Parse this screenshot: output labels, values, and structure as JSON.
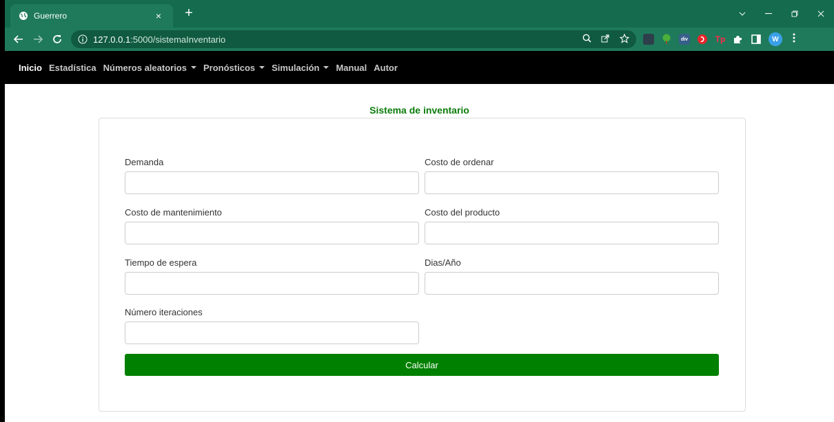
{
  "browser": {
    "tab_title": "Guerrero",
    "tab_close": "×",
    "new_tab": "+",
    "url_host": "127.0.0.1",
    "url_rest": ":5000/sistemaInventario",
    "extensions": [
      "ext-dark",
      "ext-tree",
      "ext-div",
      "ext-red",
      "ext-tp",
      "puzzle",
      "panel"
    ],
    "ext_div_label": "div",
    "ext_tp_label": "Tp",
    "profile_initial": "W",
    "accent_color": "#146b4e"
  },
  "navbar": {
    "items": [
      {
        "label": "Inicio",
        "dropdown": false,
        "active": true
      },
      {
        "label": "Estadística",
        "dropdown": false,
        "active": false
      },
      {
        "label": "Números aleatorios",
        "dropdown": true,
        "active": false
      },
      {
        "label": "Pronósticos",
        "dropdown": true,
        "active": false
      },
      {
        "label": "Simulación",
        "dropdown": true,
        "active": false
      },
      {
        "label": "Manual",
        "dropdown": false,
        "active": false
      },
      {
        "label": "Autor",
        "dropdown": false,
        "active": false
      }
    ]
  },
  "form": {
    "title": "Sistema de inventario",
    "fields": {
      "demanda": {
        "label": "Demanda",
        "value": ""
      },
      "costo_ordenar": {
        "label": "Costo de ordenar",
        "value": ""
      },
      "costo_mantenimiento": {
        "label": "Costo de mantenimiento",
        "value": ""
      },
      "costo_producto": {
        "label": "Costo del producto",
        "value": ""
      },
      "tiempo_espera": {
        "label": "Tiempo de espera",
        "value": ""
      },
      "dias_ano": {
        "label": "Dias/Año",
        "value": ""
      },
      "num_iteraciones": {
        "label": "Número iteraciones",
        "value": ""
      }
    },
    "submit_label": "Calcular",
    "button_color": "#008000",
    "title_color": "#0a7c0a"
  }
}
